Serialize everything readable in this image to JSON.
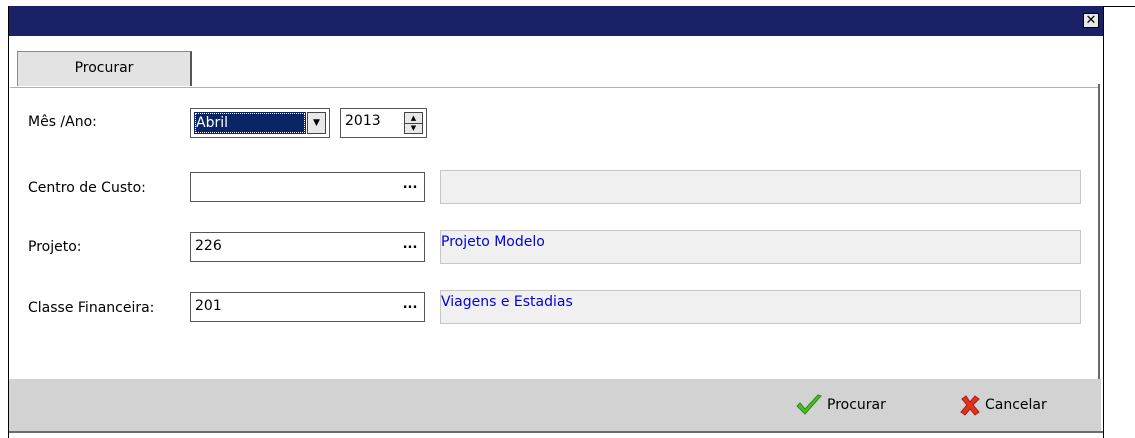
{
  "window": {
    "close_glyph": "✕"
  },
  "tabs": [
    {
      "label": "Procurar"
    }
  ],
  "form": {
    "month_year": {
      "label": "Mês /Ano:",
      "month": "Abril",
      "year": "2013"
    },
    "cost_center": {
      "label": "Centro de Custo:",
      "value": "",
      "button": "...",
      "description": ""
    },
    "project": {
      "label": "Projeto:",
      "value": "226",
      "button": "...",
      "description": "Projeto Modelo"
    },
    "financial_class": {
      "label": "Classe Financeira:",
      "value": "201",
      "button": "...",
      "description": "Viagens e Estadias"
    }
  },
  "footer": {
    "search_label": "Procurar",
    "search_icon": "check-icon",
    "cancel_label": "Cancelar",
    "cancel_icon": "x-icon"
  },
  "colors": {
    "titlebar": "#1a2166",
    "selection": "#0a2466",
    "description_text": "#0000e0",
    "check_green": "#4cbc2c",
    "cancel_red": "#e0321e"
  }
}
